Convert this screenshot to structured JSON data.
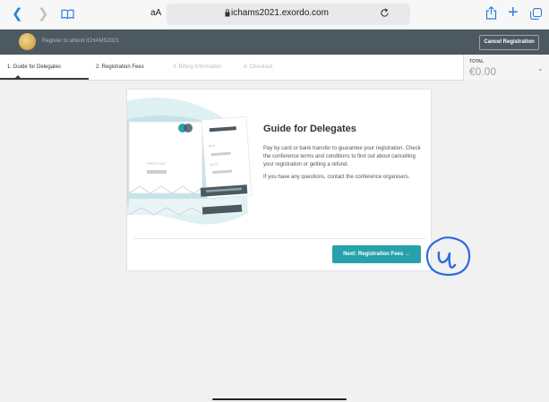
{
  "browser": {
    "back_icon": "chevron-left-icon",
    "forward_icon": "chevron-right-icon",
    "reader_label": "aA",
    "url": "ichams2021.exordo.com",
    "accent_color": "#2f7de1"
  },
  "header": {
    "title": "Register to attend ICHAMS2021",
    "cancel_label": "Cancel Registration",
    "background_color": "#4d5961"
  },
  "steps": [
    {
      "label": "1.  Guide for Delegates",
      "state": "active"
    },
    {
      "label": "2.  Registration Fees",
      "state": "pending"
    },
    {
      "label": "3.  Billing Information",
      "state": "disabled"
    },
    {
      "label": "4.  Checkout",
      "state": "disabled"
    }
  ],
  "total": {
    "label": "TOTAL",
    "value": "€0.00"
  },
  "card": {
    "title": "Guide for Delegates",
    "paragraph1": "Pay by card or bank transfer to guarantee your registration. Check the conference terms and conditions to find out about cancelling your registration or getting a refund.",
    "paragraph2": "If you have any questions, contact the conference organisers.",
    "next_label": "Next: Registration Fees  →",
    "button_color": "#27a2ad"
  },
  "annotation": {
    "stroke_color": "#2d6cdf"
  }
}
